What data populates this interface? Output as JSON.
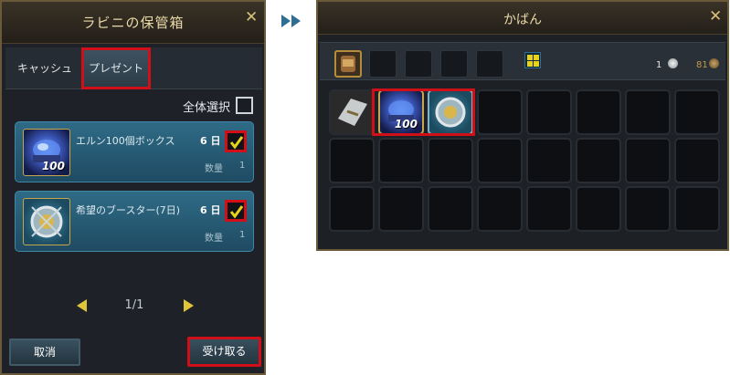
{
  "storage": {
    "title": "ラビニの保管箱",
    "tabs": [
      {
        "label": "キャッシュ",
        "selected": false
      },
      {
        "label": "プレゼント",
        "selected": true
      }
    ],
    "select_all_label": "全体選択",
    "items": [
      {
        "name": "エルン100個ボックス",
        "days": "6 日",
        "qty_label": "数量",
        "qty": "1",
        "icon_badge": "100",
        "icon": "blue-crystal-box-icon",
        "checked": true
      },
      {
        "name": "希望のブースター(7日)",
        "days": "6 日",
        "qty_label": "数量",
        "qty": "1",
        "icon": "booster-compass-icon",
        "checked": true
      }
    ],
    "pager": "1/1",
    "cancel_label": "取消",
    "receive_label": "受け取る"
  },
  "bag": {
    "title": "かばん",
    "currency_silver": "1",
    "currency_bronze": "81",
    "slot_icons": [
      "scroll-icon",
      "blue-crystal-box-icon",
      "booster-compass-icon"
    ],
    "slot_badge": "100"
  },
  "colors": {
    "highlight": "#d10f19",
    "accent_gold": "#e0c43a",
    "item_blue": "#2f6b86"
  }
}
